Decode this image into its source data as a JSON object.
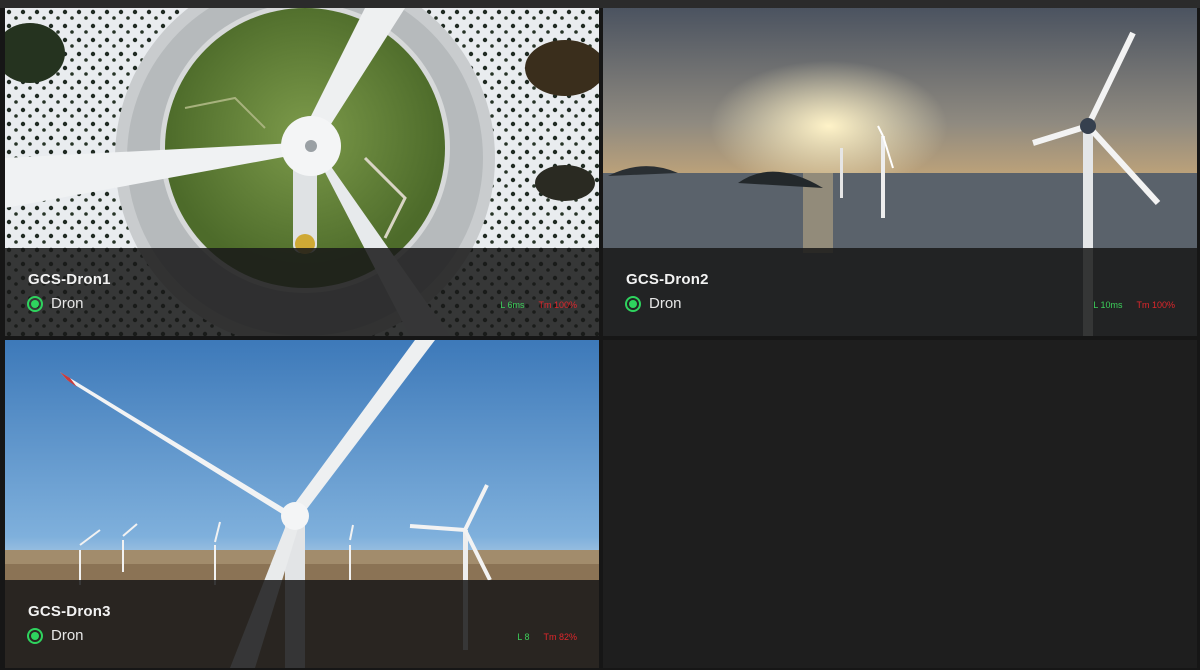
{
  "feeds": [
    {
      "name": "GCS-Dron1",
      "status": "Dron",
      "latency": "L 6ms",
      "telemetry": "Tm 100%",
      "status_color": "#2ed35e"
    },
    {
      "name": "GCS-Dron2",
      "status": "Dron",
      "latency": "L 10ms",
      "telemetry": "Tm 100%",
      "status_color": "#2ed35e"
    },
    {
      "name": "GCS-Dron3",
      "status": "Dron",
      "latency": "L 8",
      "telemetry": "Tm 82%",
      "status_color": "#2ed35e"
    }
  ],
  "colors": {
    "latency": "#3ccf5a",
    "telemetry": "#e0262b",
    "background": "#161616"
  }
}
